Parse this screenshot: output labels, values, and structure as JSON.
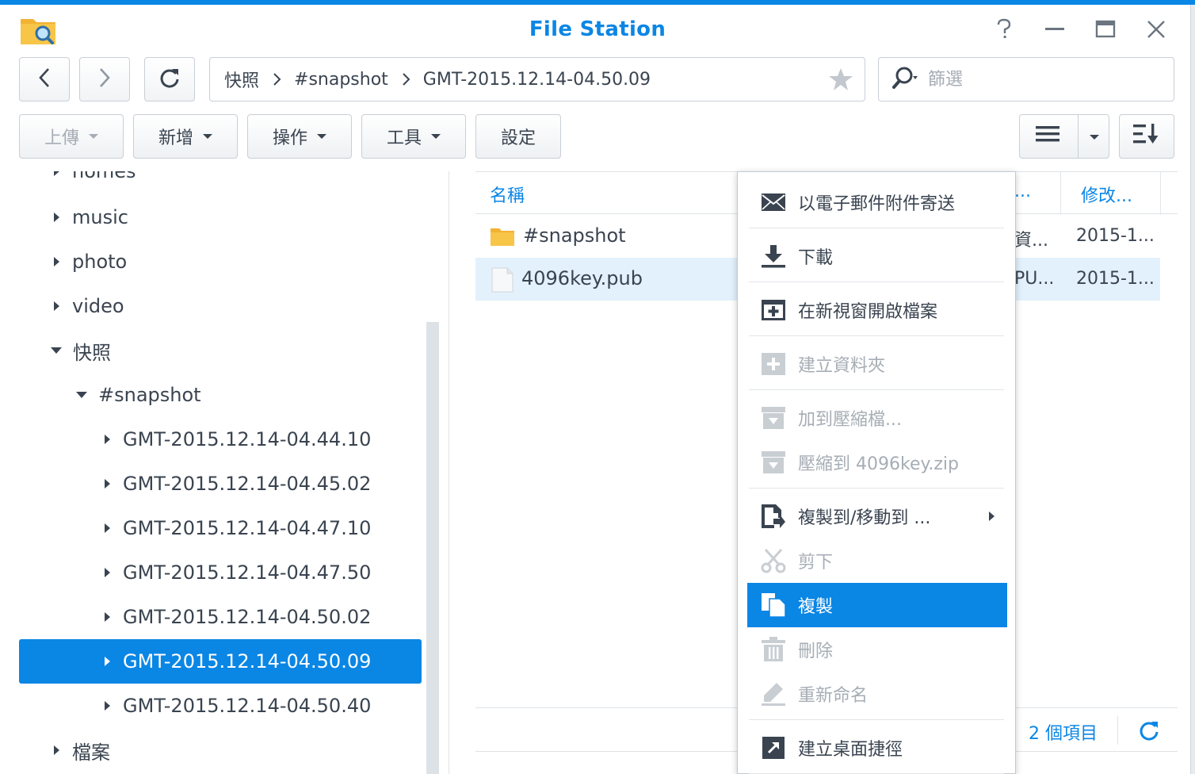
{
  "window": {
    "title": "File Station",
    "icons": {
      "app": "folder-search-icon",
      "help": "help-icon",
      "minimize": "minimize-icon",
      "maximize": "maximize-icon",
      "close": "close-icon"
    }
  },
  "nav": {
    "back_icon": "chevron-left-icon",
    "forward_icon": "chevron-right-icon",
    "refresh_icon": "refresh-icon",
    "path": [
      "快照",
      "#snapshot",
      "GMT-2015.12.14-04.50.09"
    ],
    "favorite_icon": "star-icon",
    "search_placeholder": "篩選"
  },
  "toolbar": {
    "upload": "上傳",
    "create": "新增",
    "action": "操作",
    "tools": "工具",
    "settings": "設定",
    "view_icon": "list-view-icon",
    "sort_icon": "sort-icon"
  },
  "tree": {
    "items": [
      {
        "label": "homes",
        "level": 1,
        "state": "collapsed"
      },
      {
        "label": "music",
        "level": 1,
        "state": "collapsed"
      },
      {
        "label": "photo",
        "level": 1,
        "state": "collapsed"
      },
      {
        "label": "video",
        "level": 1,
        "state": "collapsed"
      },
      {
        "label": "快照",
        "level": 1,
        "state": "expanded"
      },
      {
        "label": "#snapshot",
        "level": 2,
        "state": "expanded"
      },
      {
        "label": "GMT-2015.12.14-04.44.10",
        "level": 3,
        "state": "collapsed"
      },
      {
        "label": "GMT-2015.12.14-04.45.02",
        "level": 3,
        "state": "collapsed"
      },
      {
        "label": "GMT-2015.12.14-04.47.10",
        "level": 3,
        "state": "collapsed"
      },
      {
        "label": "GMT-2015.12.14-04.47.50",
        "level": 3,
        "state": "collapsed"
      },
      {
        "label": "GMT-2015.12.14-04.50.02",
        "level": 3,
        "state": "collapsed"
      },
      {
        "label": "GMT-2015.12.14-04.50.09",
        "level": 3,
        "state": "collapsed",
        "selected": true
      },
      {
        "label": "GMT-2015.12.14-04.50.40",
        "level": 3,
        "state": "collapsed"
      },
      {
        "label": "檔案",
        "level": 1,
        "state": "collapsed"
      }
    ]
  },
  "list": {
    "columns": {
      "name": "名稱",
      "type": "...",
      "modified": "修改..."
    },
    "rows": [
      {
        "name": "#snapshot",
        "icon": "folder-icon",
        "type": "資...",
        "modified": "2015-1..."
      },
      {
        "name": "4096key.pub",
        "icon": "file-icon",
        "type": "PU...",
        "modified": "2015-1...",
        "selected": true
      }
    ],
    "count": "2 個項目",
    "refresh_icon": "refresh-icon"
  },
  "context_menu": {
    "items": [
      {
        "label": "以電子郵件附件寄送",
        "icon": "email-icon",
        "enabled": true
      },
      {
        "label": "下載",
        "icon": "download-icon",
        "enabled": true
      },
      {
        "label": "在新視窗開啟檔案",
        "icon": "new-window-icon",
        "enabled": true
      },
      {
        "label": "建立資料夾",
        "icon": "add-folder-icon",
        "enabled": false
      },
      {
        "label": "加到壓縮檔...",
        "icon": "archive-icon",
        "enabled": false
      },
      {
        "label": "壓縮到 4096key.zip",
        "icon": "archive-icon",
        "enabled": false
      },
      {
        "label": "複製到/移動到 ...",
        "icon": "copy-move-icon",
        "enabled": true,
        "submenu": true
      },
      {
        "label": "剪下",
        "icon": "scissors-icon",
        "enabled": false
      },
      {
        "label": "複製",
        "icon": "copy-icon",
        "enabled": true,
        "active": true
      },
      {
        "label": "刪除",
        "icon": "trash-icon",
        "enabled": false
      },
      {
        "label": "重新命名",
        "icon": "pencil-icon",
        "enabled": false
      },
      {
        "label": "建立桌面捷徑",
        "icon": "shortcut-icon",
        "enabled": true
      }
    ]
  },
  "colors": {
    "accent": "#0a86e5",
    "text": "#3a4450",
    "disabled": "#a6adb5",
    "selected_row": "#e3f1fc"
  }
}
